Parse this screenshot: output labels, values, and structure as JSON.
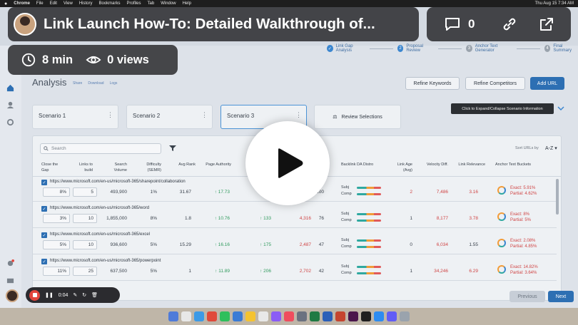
{
  "menubar": {
    "apple": "",
    "app": "Chrome",
    "items": [
      "File",
      "Edit",
      "View",
      "History",
      "Bookmarks",
      "Profiles",
      "Tab",
      "Window",
      "Help"
    ],
    "clock": "Thu Aug 15  7:34 AM"
  },
  "steps": [
    {
      "num": "✓",
      "label": "Link Gap Analysis",
      "active": true
    },
    {
      "num": "2",
      "label": "Proposal Review",
      "active": true
    },
    {
      "num": "3",
      "label": "Anchor Text Generator",
      "active": false
    },
    {
      "num": "4",
      "label": "Final Summary",
      "active": false
    }
  ],
  "page": {
    "title": "Analysis",
    "links": [
      "Share",
      "Download",
      "Logs"
    ],
    "refine_keywords": "Refine Keywords",
    "refine_competitors": "Refine Competitors",
    "add_url": "Add URL"
  },
  "scenarios": [
    "Scenario 1",
    "Scenario 2",
    "Scenario 3"
  ],
  "review_selections": "Review Selections",
  "tooltip": "Click to Expand/Collapse Scenario Information",
  "table": {
    "search_placeholder": "Search",
    "sort_label": "Sort URLs by",
    "sort_value": "A-Z",
    "headers": {
      "close_gap": "Close the Gap",
      "links_to_build": "Links to build",
      "search_volume": "Search Volume",
      "difficulty": "Difficulty (SEMR)",
      "avg_rank": "Avg Rank",
      "page_authority": "Page Authority",
      "backlink_distro": "Backlink DA Distro",
      "link_age": "Link Age (Avg)",
      "velocity": "Velocity Diff.",
      "link_relevance": "Link Relevance",
      "anchor_buckets": "Anchor Text Buckets"
    },
    "rows": [
      {
        "url": "https://www.microsoft.com/en-us/microsoft-365/sharepoint/collaboration",
        "gap": "8%",
        "links": "5",
        "volume": "493,900",
        "difficulty": "1%",
        "avg_rank": "31.67",
        "pa": "↑ 17.73",
        "col7": "↑ 223",
        "col8": "",
        "col9": "100",
        "subj": "Subj",
        "comp": "Comp",
        "link_age": "2",
        "velocity": "7,486",
        "relevance": "3.16",
        "exact": "Exact: 5.91%",
        "partial": "Partial: 4.62%"
      },
      {
        "url": "https://www.microsoft.com/en-us/microsoft-365/word",
        "gap": "3%",
        "links": "10",
        "volume": "1,855,000",
        "difficulty": "8%",
        "avg_rank": "1.8",
        "pa": "↑ 10.76",
        "col7": "↑ 133",
        "col8": "4,316",
        "col9": "76",
        "subj": "Subj",
        "comp": "Comp",
        "link_age": "1",
        "velocity": "8,177",
        "relevance": "3.78",
        "exact": "Exact: 8%",
        "partial": "Partial: 5%"
      },
      {
        "url": "https://www.microsoft.com/en-us/microsoft-365/excel",
        "gap": "5%",
        "links": "10",
        "volume": "936,600",
        "difficulty": "5%",
        "avg_rank": "15.29",
        "pa": "↑ 16.16",
        "col7": "↑ 175",
        "col8": "2,487",
        "col9": "47",
        "subj": "Subj",
        "comp": "Comp",
        "link_age": "0",
        "velocity": "6,034",
        "relevance": "1.55",
        "exact": "Exact: 2.08%",
        "partial": "Partial: 4.85%"
      },
      {
        "url": "https://www.microsoft.com/en-us/microsoft-365/powerpoint",
        "gap": "11%",
        "links": "25",
        "volume": "637,500",
        "difficulty": "5%",
        "avg_rank": "1",
        "pa": "↑ 11.89",
        "col7": "↑ 206",
        "col8": "2,702",
        "col9": "42",
        "subj": "Subj",
        "comp": "Comp",
        "link_age": "1",
        "velocity": "34,246",
        "relevance": "6.29",
        "exact": "Exact: 14.82%",
        "partial": "Partial: 3.64%"
      }
    ]
  },
  "footer": {
    "previous": "Previous",
    "next": "Next"
  },
  "loom": {
    "title": "Link Launch How-To: Detailed Walkthrough of...",
    "comments": "0",
    "duration": "8 min",
    "views": "0 views",
    "rec_time": "0:04"
  },
  "colors": {
    "primary": "#2d6fb3",
    "positive": "#2f9a5c",
    "negative": "#d04545",
    "record": "#e2453c"
  }
}
